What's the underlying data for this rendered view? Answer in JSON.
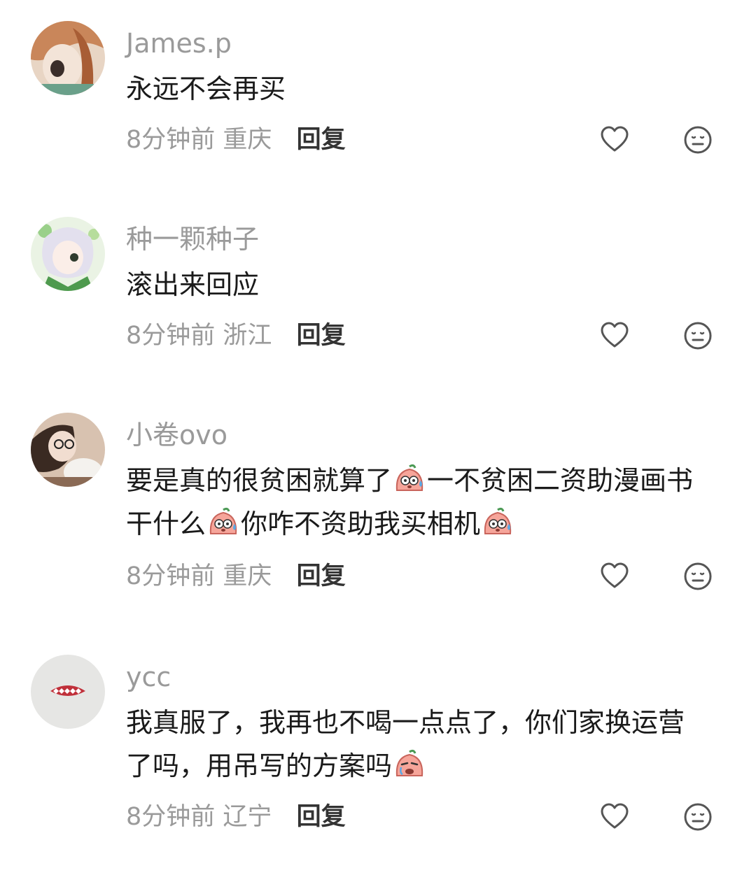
{
  "comments": [
    {
      "username": "James.p",
      "lines": [
        "永远不会再买"
      ],
      "time": "8分钟前",
      "location": "重庆",
      "reply": "回复"
    },
    {
      "username": "种一颗种子",
      "lines": [
        "滚出来回应"
      ],
      "time": "8分钟前",
      "location": "浙江",
      "reply": "回复"
    },
    {
      "username": "小卷ovo",
      "lines": [
        "要是真的很贫困就算了",
        "一不贫困二资助漫画书",
        "干什么",
        "你咋不资助我买相机"
      ],
      "time": "8分钟前",
      "location": "重庆",
      "reply": "回复"
    },
    {
      "username": "ycc",
      "lines": [
        "我真服了，我再也不喝一点点了，你们家换运营",
        "了吗，用吊写的方案吗"
      ],
      "time": "8分钟前",
      "location": "辽宁",
      "reply": "回复"
    }
  ],
  "icons": {
    "like": "heart-outline-icon",
    "react": "neutral-face-icon",
    "emoji": "sweating-peach-emoji"
  },
  "colors": {
    "text": "#1a1a1a",
    "meta": "#9a9a9a",
    "reply": "#333333",
    "icon": "#555555"
  }
}
